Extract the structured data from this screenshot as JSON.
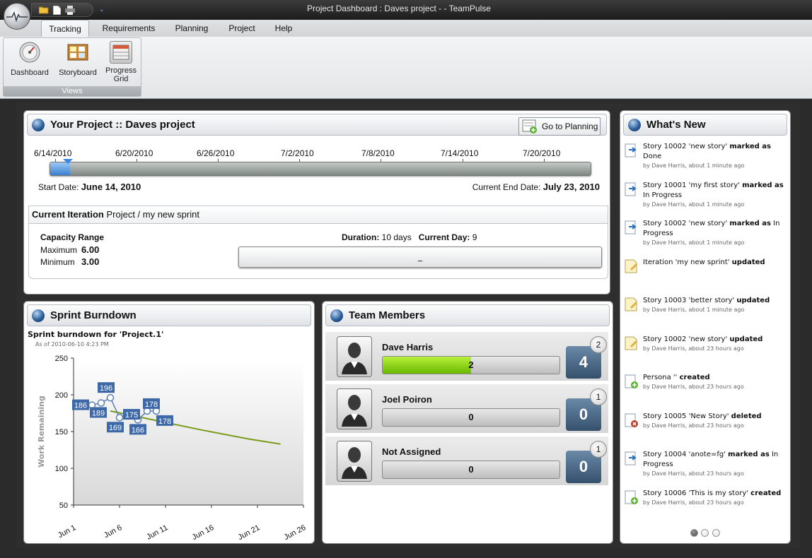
{
  "window": {
    "title": "Project Dashboard : Daves project - - TeamPulse"
  },
  "ribbon": {
    "tabs": [
      "Tracking",
      "Requirements",
      "Planning",
      "Project",
      "Help"
    ],
    "active_tab": "Tracking",
    "group_label": "Views",
    "buttons": [
      {
        "label": "Dashboard",
        "icon": "dashboard-gauge-icon"
      },
      {
        "label": "Storyboard",
        "icon": "storyboard-icon"
      },
      {
        "label": "Progress Grid",
        "icon": "progress-grid-icon"
      }
    ]
  },
  "project": {
    "title": "Your Project :: Daves project",
    "goto_planning_label": "Go to Planning",
    "timeline_dates": [
      "6/14/2010",
      "6/20/2010",
      "6/26/2010",
      "7/2/2010",
      "7/8/2010",
      "7/14/2010",
      "7/20/2010"
    ],
    "start_label": "Start Date:",
    "start_value": "June 14, 2010",
    "end_label": "Current End Date:",
    "end_value": "July 23, 2010",
    "iteration_label": "Current Iteration",
    "iteration_name": "Project / my new sprint",
    "capacity_label": "Capacity Range",
    "maximum_label": "Maximum",
    "maximum_value": "6.00",
    "minimum_label": "Minimum",
    "minimum_value": "3.00",
    "duration_label": "Duration:",
    "duration_value": "10 days",
    "current_day_label": "Current Day:",
    "current_day_value": "9",
    "capacity_bar_text": "_"
  },
  "burndown": {
    "panel_title": "Sprint Burndown",
    "chart_title": "Sprint burndown for 'Project.1'",
    "subtitle": "As of 2010-06-10 4:23 PM"
  },
  "chart_data": {
    "type": "line",
    "title": "Sprint burndown for 'Project.1'",
    "ylabel": "Work Remaining",
    "xlabel": "",
    "ylim": [
      50,
      250
    ],
    "yticks": [
      250,
      200,
      150,
      100,
      50
    ],
    "xticks": [
      "Jun 1",
      "Jun 6",
      "Jun 11",
      "Jun 16",
      "Jun 21",
      "Jun 26"
    ],
    "xlim": [
      1,
      26
    ],
    "series": [
      {
        "kind": "actual",
        "x": [
          3,
          4,
          5,
          6,
          7,
          8,
          9,
          10
        ],
        "values": [
          186,
          189,
          196,
          169,
          175,
          166,
          178,
          178
        ]
      },
      {
        "kind": "projected",
        "x": [
          5,
          10,
          15,
          20,
          23.5
        ],
        "values": [
          178,
          165,
          152,
          140,
          133
        ]
      }
    ]
  },
  "team": {
    "panel_title": "Team Members",
    "members": [
      {
        "name": "Dave Harris",
        "bar_value": "2",
        "bar_fraction": 0.5,
        "count": "4",
        "badge": "2"
      },
      {
        "name": "Joel Poiron",
        "bar_value": "0",
        "bar_fraction": 0,
        "count": "0",
        "badge": "1"
      },
      {
        "name": "Not Assigned",
        "bar_value": "0",
        "bar_fraction": 0,
        "count": "0",
        "badge": "1"
      }
    ]
  },
  "whats_new": {
    "panel_title": "What's New",
    "items": [
      {
        "icon": "story-status-icon",
        "pre": "Story 10002 'new story' ",
        "action": "marked as",
        "post": " Done",
        "meta": "by Dave Harris, about 1 minute ago"
      },
      {
        "icon": "story-status-icon",
        "pre": "Story 10001 'my first story' ",
        "action": "marked as",
        "post": " In Progress",
        "meta": "by Dave Harris, about 1 minute ago"
      },
      {
        "icon": "story-status-icon",
        "pre": "Story 10002 'new story' ",
        "action": "marked as",
        "post": " In Progress",
        "meta": "by Dave Harris, about 1 minute ago"
      },
      {
        "icon": "edit-note-icon",
        "pre": "Iteration 'my new sprint' ",
        "action": "updated",
        "post": "",
        "meta": ""
      },
      {
        "icon": "edit-note-icon",
        "pre": "Story 10003 'better story' ",
        "action": "updated",
        "post": "",
        "meta": "by Dave Harris, about 1 minute ago"
      },
      {
        "icon": "edit-note-icon",
        "pre": "Story 10002 'new story' ",
        "action": "updated",
        "post": "",
        "meta": "by Dave Harris, about 23 hours ago"
      },
      {
        "icon": "add-item-icon",
        "pre": "Persona '' ",
        "action": "created",
        "post": "",
        "meta": "by Dave Harris, about 23 hours ago"
      },
      {
        "icon": "delete-item-icon",
        "pre": "Story 10005 'New Story' ",
        "action": "deleted",
        "post": "",
        "meta": "by Dave Harris, about 23 hours ago"
      },
      {
        "icon": "story-status-icon",
        "pre": "Story 10004 'anote=fg' ",
        "action": "marked as",
        "post": " In Progress",
        "meta": "by Dave Harris, about 23 hours ago"
      },
      {
        "icon": "add-item-icon",
        "pre": "Story 10006 'This is my story' ",
        "action": "created",
        "post": "",
        "meta": "by Dave Harris, about 23 hours ago"
      }
    ],
    "pager": {
      "pages": 3,
      "current": 1
    }
  }
}
